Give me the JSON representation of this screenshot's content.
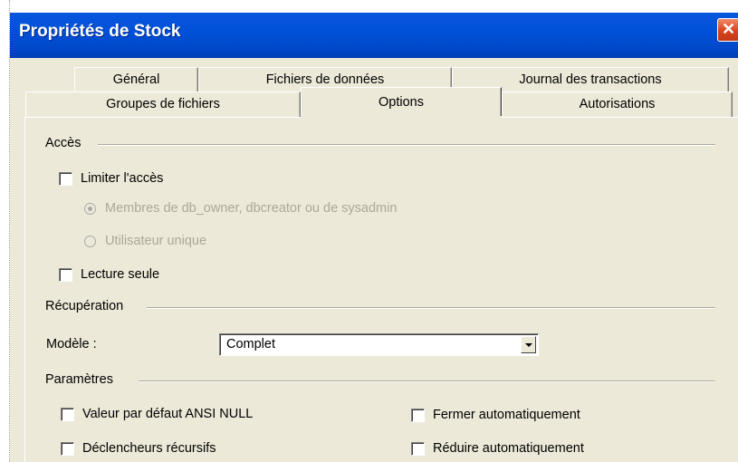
{
  "window": {
    "title": "Propriétés de Stock",
    "close_symbol": "✕"
  },
  "tabs": {
    "row_back": [
      {
        "label": "Général"
      },
      {
        "label": "Fichiers de données"
      },
      {
        "label": "Journal des transactions"
      }
    ],
    "row_front": [
      {
        "label": "Groupes de fichiers"
      },
      {
        "label": "Options",
        "active": true
      },
      {
        "label": "Autorisations"
      }
    ]
  },
  "acces": {
    "title": "Accès",
    "limiter": {
      "label": "Limiter l'accès",
      "checked": false
    },
    "radio_membres": {
      "label": "Membres de db_owner, dbcreator ou de sysadmin",
      "selected": true,
      "enabled": false
    },
    "radio_unique": {
      "label": "Utilisateur unique",
      "selected": false,
      "enabled": false
    },
    "lecture_seule": {
      "label": "Lecture seule",
      "checked": false
    }
  },
  "recuperation": {
    "title": "Récupération",
    "modele_label": "Modèle :",
    "modele_value": "Complet"
  },
  "parametres": {
    "title": "Paramètres",
    "ansi_null": {
      "label": "Valeur par défaut ANSI NULL",
      "checked": false
    },
    "fermer_auto": {
      "label": "Fermer automatiquement",
      "checked": false
    },
    "declencheurs": {
      "label": "Déclencheurs récursifs",
      "checked": false
    },
    "reduire_auto": {
      "label": "Réduire automatiquement",
      "checked": false
    }
  },
  "colors": {
    "titlebar": "#0050d8",
    "dialog_bg": "#ece9d8",
    "disabled_text": "#aca899",
    "close_button": "#d8431c"
  },
  "icons": {
    "close": "close-icon",
    "dropdown": "chevron-down-icon"
  }
}
